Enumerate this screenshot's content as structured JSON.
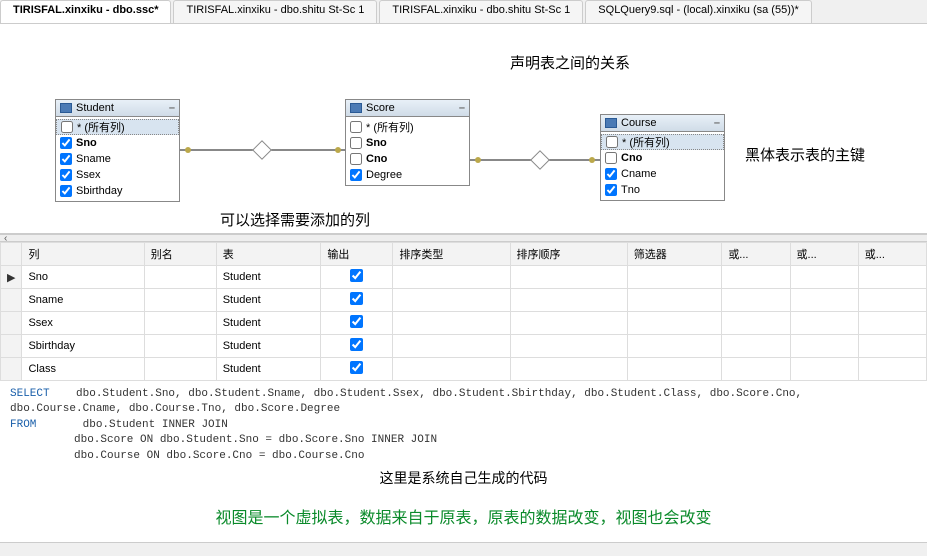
{
  "tabs": [
    {
      "label": "TIRISFAL.xinxiku - dbo.ssc*",
      "active": true
    },
    {
      "label": "TIRISFAL.xinxiku - dbo.shitu St-Sc 1",
      "active": false
    },
    {
      "label": "TIRISFAL.xinxiku - dbo.shitu St-Sc 1",
      "active": false
    },
    {
      "label": "SQLQuery9.sql - (local).xinxiku (sa (55))*",
      "active": false
    }
  ],
  "annotations": {
    "top": "声明表之间的关系",
    "left_bottom": "可以选择需要添加的列",
    "right": "黑体表示表的主键",
    "sql_cmt": "这里是系统自己生成的代码",
    "green": "视图是一个虚拟表，数据来自于原表，原表的数据改变，视图也会改变"
  },
  "tables": {
    "student": {
      "title": "Student",
      "cols": [
        {
          "name": "* (所有列)",
          "checked": false,
          "bold": false,
          "sel": true
        },
        {
          "name": "Sno",
          "checked": true,
          "bold": true
        },
        {
          "name": "Sname",
          "checked": true,
          "bold": false
        },
        {
          "name": "Ssex",
          "checked": true,
          "bold": false
        },
        {
          "name": "Sbirthday",
          "checked": true,
          "bold": false
        }
      ]
    },
    "score": {
      "title": "Score",
      "cols": [
        {
          "name": "* (所有列)",
          "checked": false,
          "bold": false
        },
        {
          "name": "Sno",
          "checked": false,
          "bold": true
        },
        {
          "name": "Cno",
          "checked": false,
          "bold": true
        },
        {
          "name": "Degree",
          "checked": true,
          "bold": false
        }
      ]
    },
    "course": {
      "title": "Course",
      "cols": [
        {
          "name": "* (所有列)",
          "checked": false,
          "bold": false,
          "sel": true
        },
        {
          "name": "Cno",
          "checked": false,
          "bold": true
        },
        {
          "name": "Cname",
          "checked": true,
          "bold": false
        },
        {
          "name": "Tno",
          "checked": true,
          "bold": false
        }
      ]
    }
  },
  "grid": {
    "headers": [
      "列",
      "别名",
      "表",
      "输出",
      "排序类型",
      "排序顺序",
      "筛选器",
      "或...",
      "或...",
      "或..."
    ],
    "rows": [
      {
        "col": "Sno",
        "alias": "",
        "table": "Student",
        "out": true,
        "marker": "▶"
      },
      {
        "col": "Sname",
        "alias": "",
        "table": "Student",
        "out": true,
        "marker": ""
      },
      {
        "col": "Ssex",
        "alias": "",
        "table": "Student",
        "out": true,
        "marker": ""
      },
      {
        "col": "Sbirthday",
        "alias": "",
        "table": "Student",
        "out": true,
        "marker": ""
      },
      {
        "col": "Class",
        "alias": "",
        "table": "Student",
        "out": true,
        "marker": ""
      }
    ]
  },
  "sql": {
    "select": "SELECT",
    "select_body": "dbo.Student.Sno, dbo.Student.Sname, dbo.Student.Ssex, dbo.Student.Sbirthday, dbo.Student.Class, dbo.Score.Cno, dbo.Course.Cname, dbo.Course.Tno, dbo.Score.Degree",
    "from": "FROM",
    "from_body1": "dbo.Student INNER JOIN",
    "from_body2": "dbo.Score ON dbo.Student.Sno = dbo.Score.Sno INNER JOIN",
    "from_body3": "dbo.Course ON dbo.Score.Cno = dbo.Course.Cno"
  }
}
